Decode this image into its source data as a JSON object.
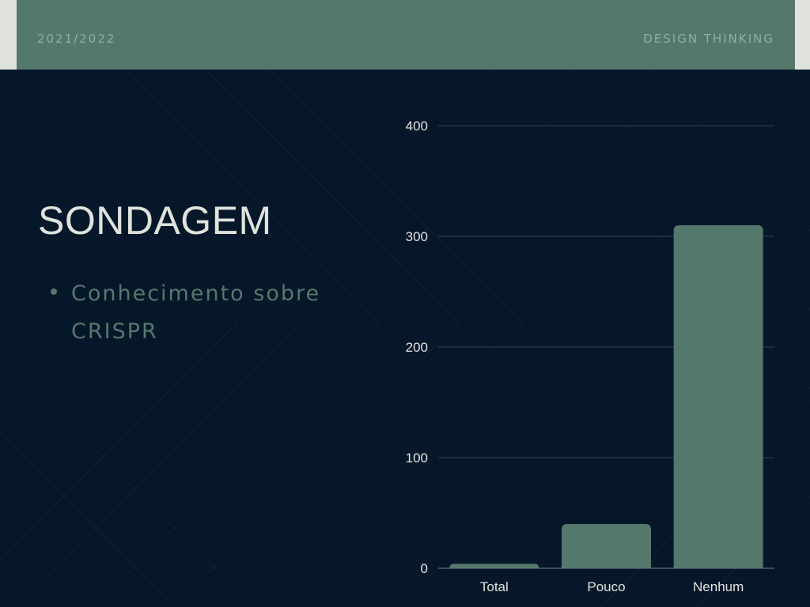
{
  "header": {
    "year": "2021/2022",
    "topic": "DESIGN THINKING"
  },
  "slide": {
    "title": "SONDAGEM",
    "bullets": [
      "Conhecimento sobre CRISPR"
    ]
  },
  "colors": {
    "background": "#07172a",
    "header": "#55786c",
    "bar": "#55786c",
    "text": "#dfe3dc"
  },
  "chart_data": {
    "type": "bar",
    "categories": [
      "Total",
      "Pouco",
      "Nenhum"
    ],
    "values": [
      4,
      40,
      310
    ],
    "ylim": [
      0,
      400
    ],
    "yticks": [
      0,
      100,
      200,
      300,
      400
    ],
    "grid": true,
    "title": "",
    "xlabel": "",
    "ylabel": ""
  }
}
